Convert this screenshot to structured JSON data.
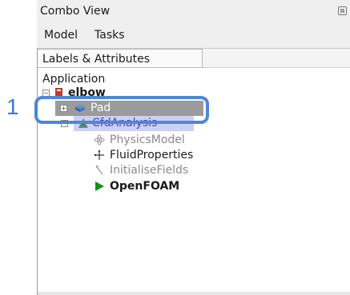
{
  "window": {
    "title": "Combo View",
    "control_glyph": "⧉"
  },
  "tabs": [
    {
      "label": "Model"
    },
    {
      "label": "Tasks"
    }
  ],
  "tree": {
    "header": "Labels & Attributes",
    "root_label": "Application",
    "items": [
      {
        "label": "elbow",
        "icon": "document-icon"
      },
      {
        "label": "Pad",
        "icon": "pad-solid-icon",
        "selected": true
      },
      {
        "label": "CfdAnalysis",
        "icon": "cfd-analysis-icon"
      },
      {
        "label": "PhysicsModel",
        "icon": "physics-atom-icon",
        "greyed": true
      },
      {
        "label": "FluidProperties",
        "icon": "fluid-properties-icon"
      },
      {
        "label": "InitialiseFields",
        "icon": "initialise-fields-icon",
        "greyed": true
      },
      {
        "label": "OpenFOAM",
        "icon": "play-triangle-icon",
        "bold": true
      }
    ]
  },
  "callout": {
    "number": "1"
  },
  "colors": {
    "selection": "#9b9b9b",
    "callout": "#4e86d8",
    "solver": "#1a8f1a"
  }
}
